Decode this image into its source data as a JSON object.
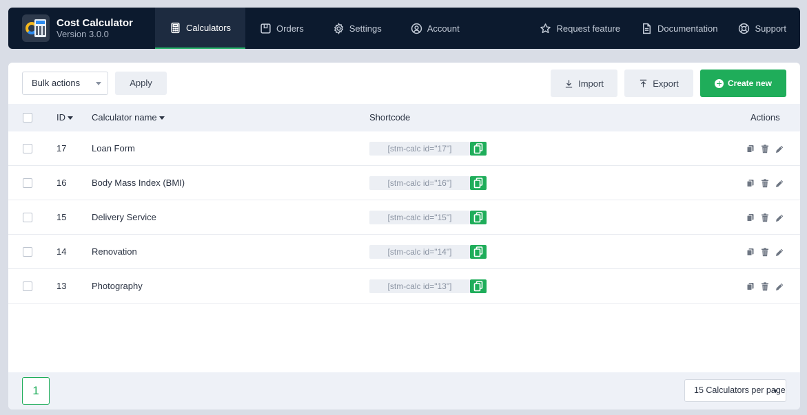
{
  "brand": {
    "title": "Cost Calculator",
    "version": "Version 3.0.0"
  },
  "nav": {
    "left": [
      {
        "label": "Calculators",
        "icon": "calculator-icon",
        "active": true
      },
      {
        "label": "Orders",
        "icon": "box-icon"
      },
      {
        "label": "Settings",
        "icon": "gear-icon"
      },
      {
        "label": "Account",
        "icon": "user-circle-icon"
      }
    ],
    "right": [
      {
        "label": "Request feature",
        "icon": "star-icon"
      },
      {
        "label": "Documentation",
        "icon": "document-icon"
      },
      {
        "label": "Support",
        "icon": "lifebuoy-icon"
      }
    ]
  },
  "toolbar": {
    "bulk_actions": "Bulk actions",
    "apply": "Apply",
    "import": "Import",
    "export": "Export",
    "create_new": "Create new"
  },
  "table": {
    "headers": {
      "id": "ID",
      "name": "Calculator name",
      "shortcode": "Shortcode",
      "actions": "Actions"
    },
    "rows": [
      {
        "id": "17",
        "name": "Loan Form",
        "shortcode": "[stm-calc id=\"17\"]"
      },
      {
        "id": "16",
        "name": "Body Mass Index (BMI)",
        "shortcode": "[stm-calc id=\"16\"]"
      },
      {
        "id": "15",
        "name": "Delivery Service",
        "shortcode": "[stm-calc id=\"15\"]"
      },
      {
        "id": "14",
        "name": "Renovation",
        "shortcode": "[stm-calc id=\"14\"]"
      },
      {
        "id": "13",
        "name": "Photography",
        "shortcode": "[stm-calc id=\"13\"]"
      }
    ]
  },
  "pagination": {
    "current_page": "1",
    "per_page": "15 Calculators per page"
  },
  "colors": {
    "nav_bg": "#0c1a2e",
    "accent": "#1fad5a",
    "header_bg": "#eef1f7"
  }
}
